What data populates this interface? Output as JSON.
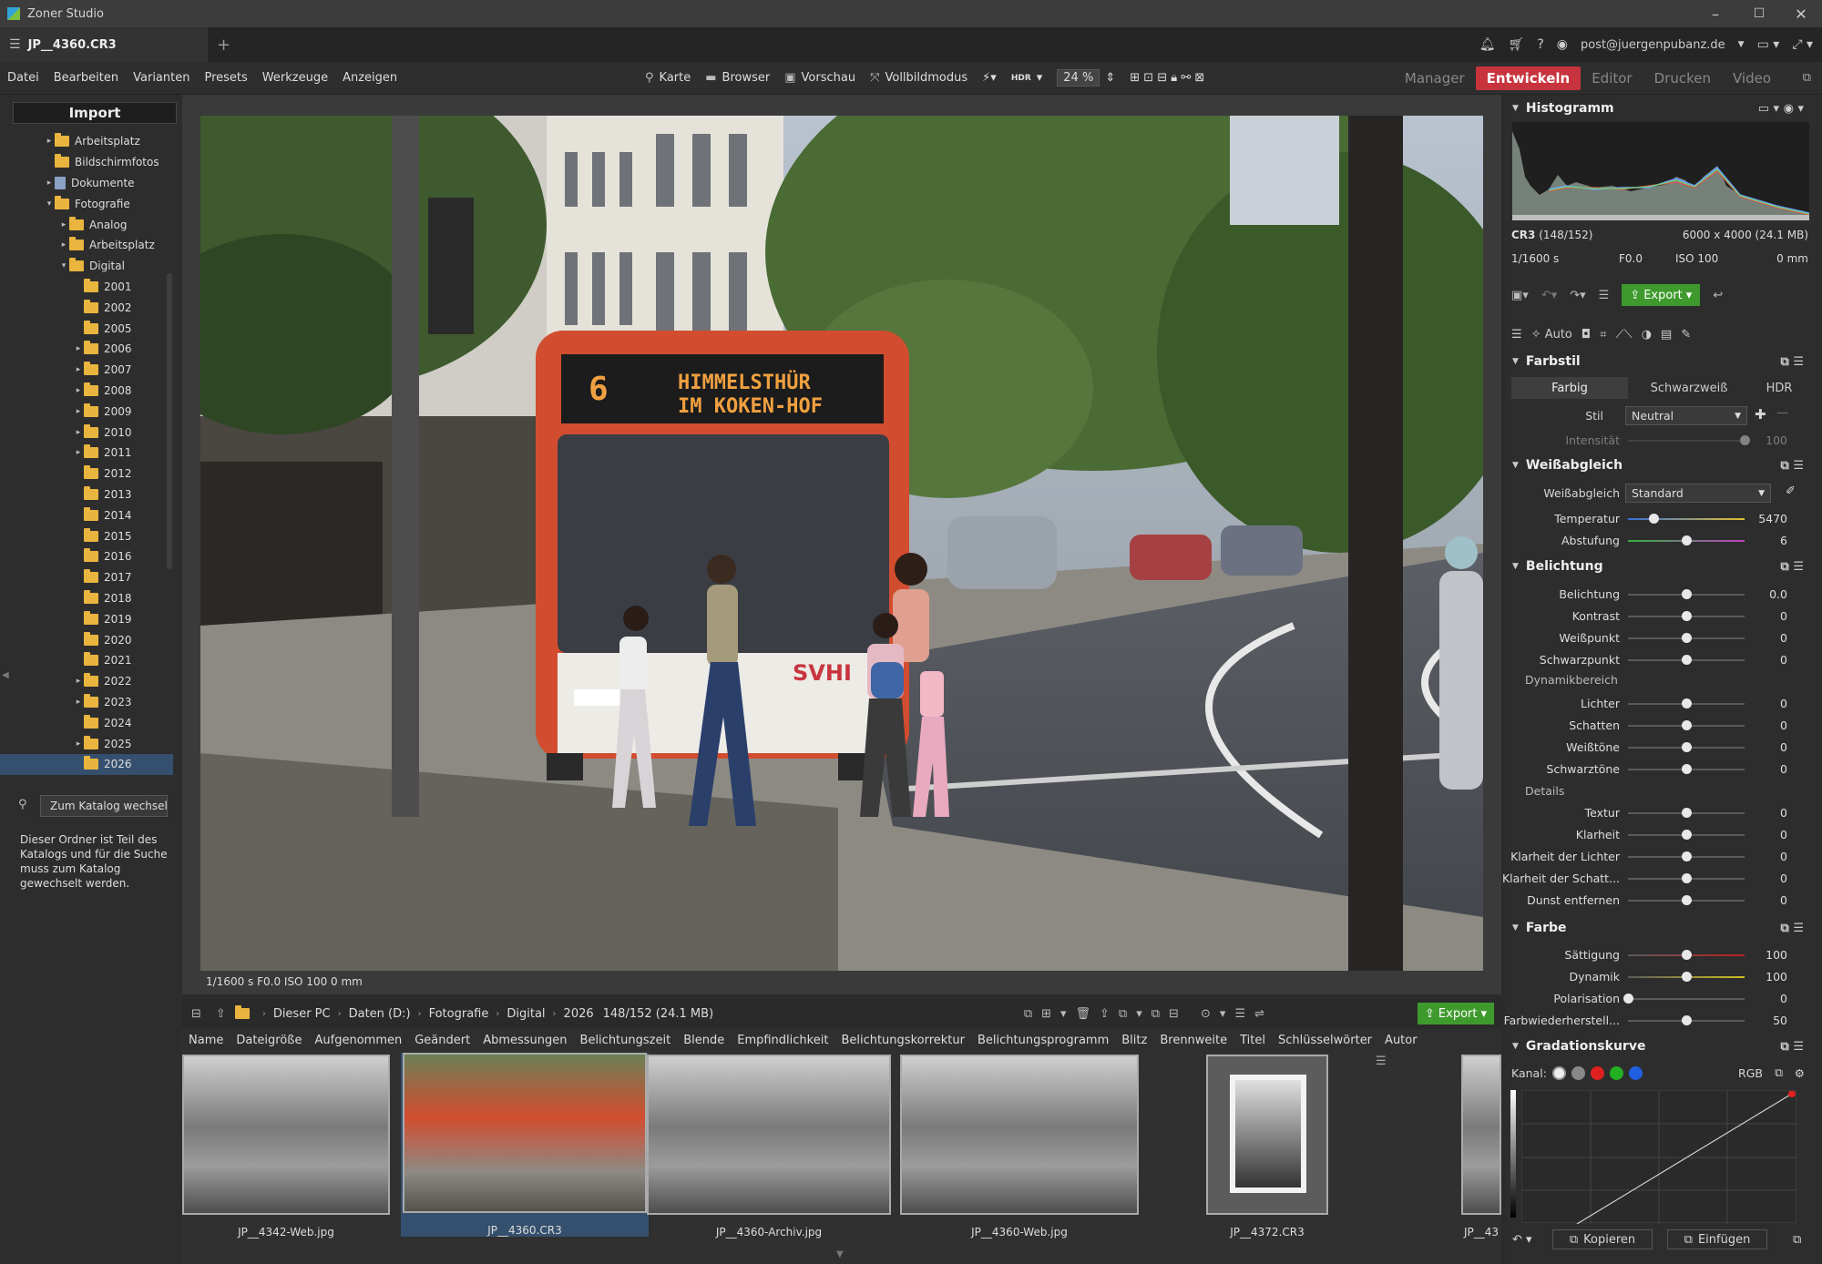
{
  "window": {
    "app_title": "Zoner Studio",
    "minimize": "–",
    "maximize": "☐",
    "close": "✕"
  },
  "tabbar": {
    "doc_tab": "JP__4360.CR3",
    "add": "+",
    "account": "post@juergenpubanz.de"
  },
  "menu": [
    "Datei",
    "Bearbeiten",
    "Varianten",
    "Presets",
    "Werkzeuge",
    "Anzeigen"
  ],
  "toolbar": {
    "karte": "Karte",
    "browser": "Browser",
    "vorschau": "Vorschau",
    "vollbild": "Vollbildmodus",
    "hdr": "HDR",
    "zoom": "24 %"
  },
  "modes": [
    "Manager",
    "Entwickeln",
    "Editor",
    "Drucken",
    "Video"
  ],
  "left": {
    "import": "Import",
    "tree": [
      {
        "label": "Arbeitsplatz",
        "arrow": "▸",
        "indent": 0
      },
      {
        "label": "Bildschirmfotos",
        "arrow": "",
        "indent": 0
      },
      {
        "label": "Dokumente",
        "arrow": "▸",
        "indent": 0,
        "doc": true
      },
      {
        "label": "Fotografie",
        "arrow": "▾",
        "indent": 0
      },
      {
        "label": "Analog",
        "arrow": "▸",
        "indent": 1
      },
      {
        "label": "Arbeitsplatz",
        "arrow": "▸",
        "indent": 1
      },
      {
        "label": "Digital",
        "arrow": "▾",
        "indent": 1
      },
      {
        "label": "2001",
        "arrow": "",
        "indent": 2
      },
      {
        "label": "2002",
        "arrow": "",
        "indent": 2
      },
      {
        "label": "2005",
        "arrow": "",
        "indent": 2
      },
      {
        "label": "2006",
        "arrow": "▸",
        "indent": 2
      },
      {
        "label": "2007",
        "arrow": "▸",
        "indent": 2
      },
      {
        "label": "2008",
        "arrow": "▸",
        "indent": 2
      },
      {
        "label": "2009",
        "arrow": "▸",
        "indent": 2
      },
      {
        "label": "2010",
        "arrow": "▸",
        "indent": 2
      },
      {
        "label": "2011",
        "arrow": "▸",
        "indent": 2
      },
      {
        "label": "2012",
        "arrow": "",
        "indent": 2
      },
      {
        "label": "2013",
        "arrow": "",
        "indent": 2
      },
      {
        "label": "2014",
        "arrow": "",
        "indent": 2
      },
      {
        "label": "2015",
        "arrow": "",
        "indent": 2
      },
      {
        "label": "2016",
        "arrow": "",
        "indent": 2
      },
      {
        "label": "2017",
        "arrow": "",
        "indent": 2
      },
      {
        "label": "2018",
        "arrow": "",
        "indent": 2
      },
      {
        "label": "2019",
        "arrow": "",
        "indent": 2
      },
      {
        "label": "2020",
        "arrow": "",
        "indent": 2
      },
      {
        "label": "2021",
        "arrow": "",
        "indent": 2
      },
      {
        "label": "2022",
        "arrow": "▸",
        "indent": 2
      },
      {
        "label": "2023",
        "arrow": "▸",
        "indent": 2
      },
      {
        "label": "2024",
        "arrow": "",
        "indent": 2
      },
      {
        "label": "2025",
        "arrow": "▸",
        "indent": 2
      },
      {
        "label": "2026",
        "arrow": "",
        "indent": 2,
        "selected": true
      }
    ],
    "catalog_button": "Zum Katalog wechseln",
    "catalog_note": "Dieser Ordner ist Teil des Katalogs und für die Suche muss zum Katalog gewechselt werden."
  },
  "photo": {
    "bus_line": "6",
    "bus_dest_1": "HIMMELSTHÜR",
    "bus_dest_2": "IM KOKEN-HOF",
    "bus_logo": "SVHI",
    "exif": "1/1600 s   F0.0   ISO 100   0 mm"
  },
  "browser": {
    "path": [
      "Dieser PC",
      "Daten (D:)",
      "Fotografie",
      "Digital",
      "2026"
    ],
    "count": "148/152 (24.1 MB)",
    "export": "Export",
    "columns": [
      "Name",
      "Dateigröße",
      "Aufgenommen",
      "Geändert",
      "Abmessungen",
      "Belichtungszeit",
      "Blende",
      "Empfindlichkeit",
      "Belichtungskorrektur",
      "Belichtungsprogramm",
      "Blitz",
      "Brennweite",
      "Titel",
      "Schlüsselwörter",
      "Autor"
    ],
    "thumbs": [
      "JP__4342-Web.jpg",
      "JP__4360.CR3",
      "JP__4360-Archiv.jpg",
      "JP__4360-Web.jpg",
      "JP__4372.CR3",
      "JP__43"
    ]
  },
  "right": {
    "histogram_title": "Histogramm",
    "file_info": "CR3",
    "file_count": "(148/152)",
    "dims": "6000 x 4000 (24.1 MB)",
    "shutter": "1/1600 s",
    "aperture": "F0.0",
    "iso": "ISO 100",
    "focal": "0 mm",
    "export": "Export",
    "auto": "Auto",
    "farbstil": {
      "title": "Farbstil",
      "tabs": [
        "Farbig",
        "Schwarzweiß",
        "HDR"
      ],
      "stil_label": "Stil",
      "stil_value": "Neutral",
      "intensitaet": "Intensität",
      "intensitaet_val": "100"
    },
    "weiss": {
      "title": "Weißabgleich",
      "wb_label": "Weißabgleich",
      "wb_value": "Standard"
    },
    "belichtung_title": "Belichtung",
    "dynamik_sub": "Dynamikbereich",
    "details_sub": "Details",
    "farbe_title": "Farbe",
    "gradation": {
      "title": "Gradationskurve",
      "kanal": "Kanal:",
      "rgb": "RGB"
    },
    "sliders": [
      {
        "label": "Temperatur",
        "value": "5470",
        "pos": 0.22,
        "grad": "temp"
      },
      {
        "label": "Abstufung",
        "value": "6",
        "pos": 0.5,
        "grad": "tint"
      },
      {
        "label": "Belichtung",
        "value": "0.0",
        "pos": 0.5
      },
      {
        "label": "Kontrast",
        "value": "0",
        "pos": 0.5
      },
      {
        "label": "Weißpunkt",
        "value": "0",
        "pos": 0.5
      },
      {
        "label": "Schwarzpunkt",
        "value": "0",
        "pos": 0.5
      },
      {
        "label": "Lichter",
        "value": "0",
        "pos": 0.5
      },
      {
        "label": "Schatten",
        "value": "0",
        "pos": 0.5
      },
      {
        "label": "Weißtöne",
        "value": "0",
        "pos": 0.5
      },
      {
        "label": "Schwarztöne",
        "value": "0",
        "pos": 0.5
      },
      {
        "label": "Textur",
        "value": "0",
        "pos": 0.5
      },
      {
        "label": "Klarheit",
        "value": "0",
        "pos": 0.5
      },
      {
        "label": "Klarheit der Lichter",
        "value": "0",
        "pos": 0.5
      },
      {
        "label": "Klarheit der Schatt...",
        "value": "0",
        "pos": 0.5
      },
      {
        "label": "Dunst entfernen",
        "value": "0",
        "pos": 0.5
      },
      {
        "label": "Sättigung",
        "value": "100",
        "pos": 0.5,
        "grad": "sat"
      },
      {
        "label": "Dynamik",
        "value": "100",
        "pos": 0.5,
        "grad": "dyn"
      },
      {
        "label": "Polarisation",
        "value": "0",
        "pos": 0.0
      },
      {
        "label": "Farbwiederherstell...",
        "value": "50",
        "pos": 0.5
      }
    ],
    "kopieren": "Kopieren",
    "einfuegen": "Einfügen"
  },
  "colors": {
    "accent_red": "#c8343e",
    "export_green": "#3f9a2e",
    "selection": "#35506e"
  }
}
